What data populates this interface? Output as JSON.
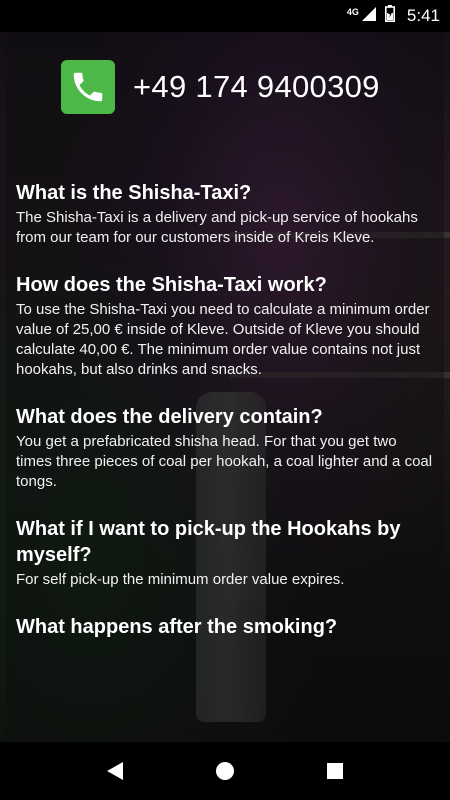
{
  "status_bar": {
    "network": "4G",
    "time": "5:41",
    "icons": [
      "signal-icon",
      "battery-icon"
    ]
  },
  "contact": {
    "icon": "phone-icon",
    "phone_number": "+49 174 9400309",
    "icon_color": "#4cb847"
  },
  "faq": [
    {
      "question": "What is the Shisha-Taxi?",
      "answer": "The Shisha-Taxi is a delivery and pick-up service of hookahs from our team for our customers inside of Kreis Kleve."
    },
    {
      "question": "How does the Shisha-Taxi work?",
      "answer": "To use the Shisha-Taxi you need to calculate a minimum order value of 25,00 € inside of Kleve. Outside of Kleve you should calculate 40,00 €. The minimum order value contains not just hookahs, but also drinks and snacks."
    },
    {
      "question": "What does the delivery contain?",
      "answer": "You get a prefabricated shisha head. For that you get two times three pieces of coal per hookah, a coal lighter and a coal tongs."
    },
    {
      "question": "What if I want to pick-up the Hookahs by myself?",
      "answer": "For self pick-up the minimum order value expires."
    },
    {
      "question": "What happens after the smoking?",
      "answer": ""
    }
  ],
  "nav_bar": {
    "buttons": [
      "back-icon",
      "home-icon",
      "recents-icon"
    ]
  }
}
